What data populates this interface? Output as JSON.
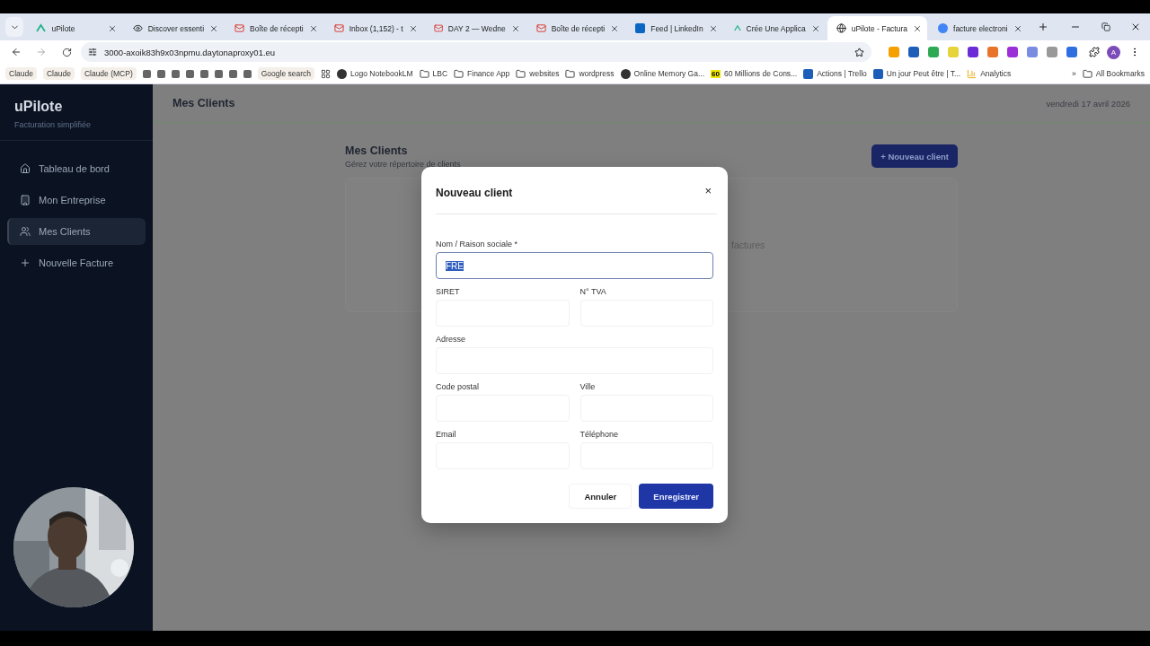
{
  "browser": {
    "tabs": [
      {
        "title": "uPilote",
        "kind": "app",
        "selected": false
      },
      {
        "title": "Discover essenti",
        "kind": "eye",
        "selected": false
      },
      {
        "title": "Boîte de récepti",
        "kind": "mail",
        "selected": false
      },
      {
        "title": "Inbox (1,152) - t",
        "kind": "mail",
        "selected": false
      },
      {
        "title": "DAY 2 — Wedne",
        "kind": "mail",
        "selected": false
      },
      {
        "title": "Boîte de récepti",
        "kind": "mail",
        "selected": false
      },
      {
        "title": "Feed | LinkedIn",
        "kind": "linkedin",
        "selected": false
      },
      {
        "title": "Crée Une Applica",
        "kind": "app",
        "selected": false
      },
      {
        "title": "uPilote - Factura",
        "kind": "globe",
        "selected": true
      },
      {
        "title": "facture electroni",
        "kind": "google",
        "selected": false
      }
    ],
    "address": "3000-axoik83h9x03npmu.daytonaproxy01.eu",
    "avatar": "A",
    "bookmarks": [
      {
        "label": "Claude",
        "kind": "chip"
      },
      {
        "label": "Claude",
        "kind": "chip"
      },
      {
        "label": "Claude (MCP)",
        "kind": "chip"
      },
      {
        "kind": "square"
      },
      {
        "kind": "square"
      },
      {
        "kind": "square"
      },
      {
        "kind": "square"
      },
      {
        "kind": "square"
      },
      {
        "kind": "square"
      },
      {
        "kind": "square"
      },
      {
        "kind": "square"
      },
      {
        "label": "Google search",
        "kind": "chip"
      },
      {
        "kind": "apps"
      },
      {
        "label": "Logo NotebookLM",
        "kind": "site"
      },
      {
        "label": "LBC",
        "kind": "folder"
      },
      {
        "label": "Finance App",
        "kind": "folder"
      },
      {
        "label": "websites",
        "kind": "folder"
      },
      {
        "label": "wordpress",
        "kind": "folder"
      },
      {
        "label": "Online Memory Ga...",
        "kind": "site"
      },
      {
        "label": "60 Millions de Cons...",
        "kind": "badge",
        "badge": "60"
      },
      {
        "label": "Actions | Trello",
        "kind": "trello"
      },
      {
        "label": "Un jour Peut être | T...",
        "kind": "trello"
      },
      {
        "label": "Analytics",
        "kind": "chart"
      },
      {
        "label": "»",
        "kind": "more"
      },
      {
        "label": "All Bookmarks",
        "kind": "folder"
      }
    ]
  },
  "sidebar": {
    "brand": "uPilote",
    "tagline": "Facturation simplifiée",
    "items": [
      {
        "label": "Tableau de bord",
        "kind": "home",
        "selected": false
      },
      {
        "label": "Mon Entreprise",
        "kind": "building",
        "selected": false
      },
      {
        "label": "Mes Clients",
        "kind": "users",
        "selected": true
      },
      {
        "label": "Nouvelle Facture",
        "kind": "plus",
        "selected": false
      }
    ]
  },
  "header": {
    "title": "Mes Clients",
    "date": "vendredi 17 avril 2026"
  },
  "page": {
    "title": "Mes Clients",
    "subtitle": "Gérez votre répertoire de clients",
    "new_button": "+ Nouveau client",
    "card_text": "factures"
  },
  "modal": {
    "title": "Nouveau client",
    "close": "×",
    "rows": [
      {
        "fields": [
          {
            "label": "Nom / Raison sociale *",
            "value": "FRE",
            "focused": true,
            "text_selected": true
          }
        ]
      },
      {
        "fields": [
          {
            "label": "SIRET",
            "focused": false
          },
          {
            "label": "N° TVA",
            "focused": false
          }
        ]
      },
      {
        "fields": [
          {
            "label": "Adresse",
            "focused": false
          }
        ]
      },
      {
        "fields": [
          {
            "label": "Code postal",
            "focused": false
          },
          {
            "label": "Ville",
            "focused": false
          }
        ]
      },
      {
        "fields": [
          {
            "label": "Email",
            "focused": false
          },
          {
            "label": "Téléphone",
            "focused": false
          }
        ]
      }
    ],
    "buttons": [
      {
        "label": "Annuler",
        "kind": "secondary"
      },
      {
        "label": "Enregistrer",
        "kind": "primary"
      }
    ]
  }
}
